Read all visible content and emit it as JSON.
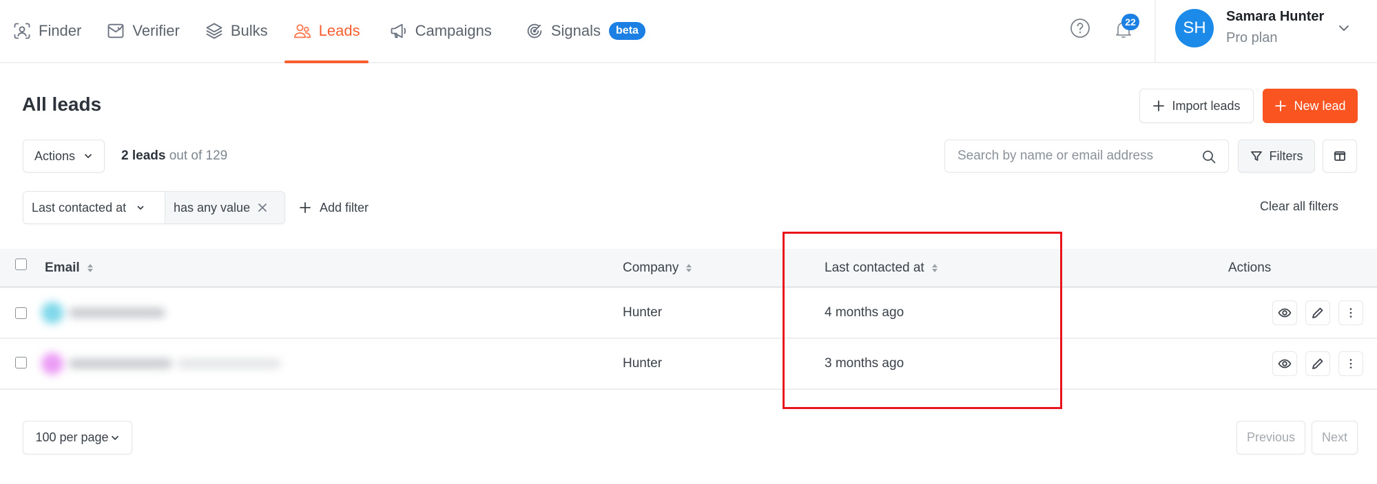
{
  "nav": {
    "items": [
      {
        "label": "Finder",
        "icon": "user-scan-icon",
        "active": false
      },
      {
        "label": "Verifier",
        "icon": "mail-check-icon",
        "active": false
      },
      {
        "label": "Bulks",
        "icon": "layers-icon",
        "active": false
      },
      {
        "label": "Leads",
        "icon": "users-icon",
        "active": true
      },
      {
        "label": "Campaigns",
        "icon": "megaphone-icon",
        "active": false
      },
      {
        "label": "Signals",
        "icon": "radar-icon",
        "active": false,
        "badge": "beta"
      }
    ],
    "notifications_count": "22",
    "accent_color": "#f75d2f",
    "badge_color": "#1b7fe3"
  },
  "user": {
    "initials": "SH",
    "name": "Samara Hunter",
    "plan": "Pro plan"
  },
  "page": {
    "title": "All leads",
    "import_label": "Import leads",
    "new_lead_label": "New lead",
    "actions_label": "Actions",
    "count_bold": "2 leads",
    "count_rest": " out of 129",
    "search_placeholder": "Search by name or email address",
    "search_value": "",
    "filters_label": "Filters",
    "clear_filters_label": "Clear all filters",
    "add_filter_label": "Add filter"
  },
  "active_filter": {
    "field": "Last contacted at",
    "value": "has any value"
  },
  "table": {
    "columns": [
      {
        "label": "Email",
        "sortable": true
      },
      {
        "label": "Company",
        "sortable": true
      },
      {
        "label": "Last contacted at",
        "sortable": true
      },
      {
        "label": "Actions",
        "sortable": false
      }
    ],
    "rows": [
      {
        "email": "[redacted]",
        "avatar_color": "#7fd8ea",
        "company": "Hunter",
        "last_contacted": "4 months ago"
      },
      {
        "email": "[redacted]",
        "avatar_color": "#ec9cf5",
        "company": "Hunter",
        "last_contacted": "3 months ago"
      }
    ]
  },
  "pagination": {
    "per_page_label": "100 per page",
    "previous_label": "Previous",
    "next_label": "Next",
    "previous_enabled": false,
    "next_enabled": false
  },
  "annotation": {
    "highlighted_column": "Last contacted at",
    "color": "#e9141b"
  }
}
